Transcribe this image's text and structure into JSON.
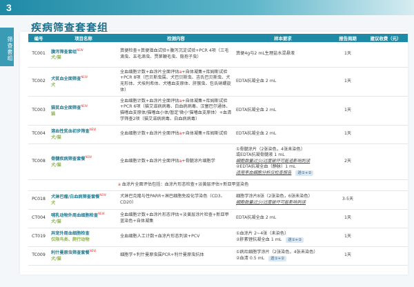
{
  "page_number": "3",
  "side_tab": "筛查套组",
  "title": "疾病筛查套套组",
  "columns": [
    "编号",
    "项目名称",
    "检测内容",
    "样本要求",
    "报告周期",
    "建议收费（元）"
  ],
  "rows": [
    {
      "code": "TC001",
      "name": "腹泻筛查套组",
      "new": "NEW",
      "species": "犬/猫",
      "content": "粪便检查+粪便潜血试验+腹泻沉淀试验+PCR 4项（三毛滴虫、五毛滴虫、贾第鞭毛虫、隐孢子虫）",
      "sample": "粪便4g与2 mL生理盐水混悬液",
      "cycle": "1天",
      "fee": ""
    },
    {
      "code": "TC002",
      "name": "犬贫血全面筛查",
      "new": "NEW",
      "species": "犬",
      "content": "全血细胞计数+血涂片全面评估a+自体凝集+库姆斯试验+PCR 8项（巴贝斯虫属、犬巴贝斯虫、吉氏巴贝斯虫、犬无形体、犬埃利希体、犬嗜血支原体、肝簇虫、包氏硝螺旋体）",
      "sample": "EDTA抗凝全血 2 mL",
      "cycle": "1天",
      "fee": ""
    },
    {
      "code": "TC003",
      "name": "猫贫血全面筛查",
      "new": "NEW",
      "species": "猫",
      "content": "全血细胞计数+血涂片全面评估a+自体凝集+库姆斯试验+PCR 6项（猫艾滋病病毒、白血病病毒、汉塞巴尔通体、猫嗜血支原体/猫嗜血小体/暂定'微小'猫嗜血支原体）+血清学筛查2项（猫艾滋病病毒、白血病病毒）",
      "sample": "EDTA抗凝全血 2 mL",
      "cycle": "1天",
      "fee": ""
    },
    {
      "code": "TC004",
      "name": "溶血性贫血初步筛查",
      "new": "NEW",
      "species": "犬/猫",
      "content": "全血细胞计数+血涂片全面评估a+自体凝集+库姆斯试验",
      "sample": "EDTA抗凝全血 2 mL",
      "cycle": "1天",
      "fee": ""
    },
    {
      "code": "TC008",
      "name": "骨髓疾病筛查套餐",
      "new": "NEW",
      "species": "犬/猫",
      "content": "全血细胞计数+血涂片全面评估a+骨髓涂片细胞学",
      "sample_lines": [
        "①骨髓涂片（2张染色，4张未染色）",
        "或EDTA抗凝骨髓液 1 mL",
        "细胞数量过少/过度破坏可能追影响判读",
        "②EDTA抗凝全血（静脉）1 mL",
        "适用率血细胞分析仪检查报告"
      ],
      "badge": "送①+②",
      "cycle": "2天",
      "fee": ""
    },
    {
      "code": "PC018",
      "name": "犬淋巴瘤/白血病筛查套餐",
      "new": "NEW",
      "species": "犬",
      "content": "犬淋巴克隆与性PARR+淋巴细胞免疫化学染色（CD3、CD20）",
      "sample_lines": [
        "细胞学涂片8张（2张染色，6张未染色）",
        "细胞数量过少/过度破坏可能影响判读"
      ],
      "cycle": "3-5天",
      "fee": ""
    },
    {
      "code": "CT004",
      "name": "哺乳动物外周血细胞检查",
      "new": "NEW",
      "species": "犬/猫",
      "content": "全血细胞计数+血涂片形态评估+淡黄层涂片检查+新亚甲蓝染色+自体凝集",
      "sample": "EDTA抗凝全血 2 mL",
      "cycle": "1天",
      "fee": ""
    },
    {
      "code": "CT019",
      "name": "异宠外周血细胞检查",
      "name2": "仅限鸟类、爬行动物",
      "species": "",
      "content": "全血细胞人工计数+血涂片形态判读+PCV",
      "sample_lines": [
        "①血涂片 2~4张（未染色）",
        "②肝素锂抗凝全血 1 mL"
      ],
      "badge": "送①+②",
      "cycle": "1天",
      "fee": ""
    },
    {
      "code": "TC009",
      "name": "利什曼原虫筛查套餐",
      "new": "NEW",
      "species": "犬/猫",
      "content": "细胞学+利什曼原虫属PCR+利什曼原虫抗体",
      "sample_lines": [
        "①病灶细胞学涂片（2张染色，4张未染色）",
        "②血清 0.5 mL"
      ],
      "badge": "送①+②",
      "cycle": "1天",
      "fee": ""
    }
  ],
  "note": "a 血涂片全面评估包括：血涂片形态检查+淡黄层评估+新亚甲蓝染色"
}
